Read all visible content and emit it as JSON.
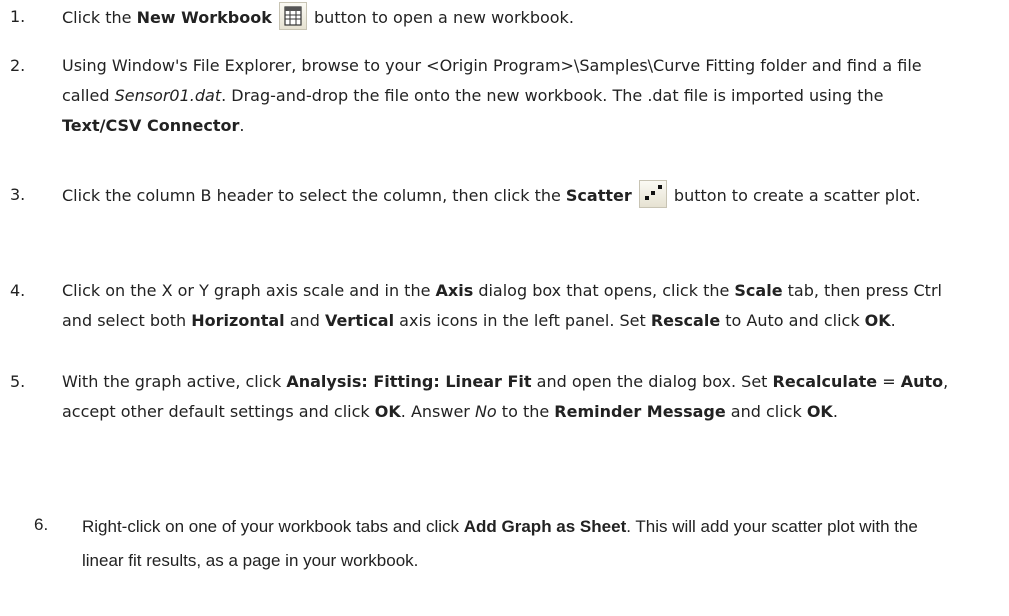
{
  "steps": [
    {
      "number": "1.",
      "parts": {
        "a": "Click the ",
        "b": "New Workbook",
        "c": " button to open a new workbook."
      },
      "icon": "new-workbook-icon"
    },
    {
      "number": "2.",
      "parts": {
        "a": "Using Window's File Explorer, browse to your <Origin Program>\\Samples\\Curve Fitting folder and find a file called ",
        "b": "Sensor01.dat",
        "c": ". Drag-and-drop the file onto the new workbook. The .dat file is imported using the ",
        "d": "Text/CSV Connector",
        "e": "."
      }
    },
    {
      "number": "3.",
      "parts": {
        "a": "Click the column B header to select the column, then click the ",
        "b": "Scatter",
        "c": " button to create a scatter plot."
      },
      "icon": "scatter-icon"
    },
    {
      "number": "4.",
      "parts": {
        "a": "Click on the X or Y graph axis scale and in the ",
        "b": "Axis",
        "c": " dialog box that opens, click the ",
        "d": "Scale",
        "e": " tab, then press Ctrl and select both ",
        "f": "Horizontal",
        "g": " and ",
        "h": "Vertical",
        "i": " axis icons in the left panel. Set ",
        "j": "Rescale",
        "k": " to Auto and click ",
        "l": "OK",
        "m": "."
      }
    },
    {
      "number": "5.",
      "parts": {
        "a": "With the graph active, click ",
        "b": "Analysis: Fitting: Linear Fit",
        "c": " and open the dialog box. Set ",
        "d": "Recalculate",
        "e": " = ",
        "f": "Auto",
        "g": ", accept other default settings and click ",
        "h": "OK",
        "i": ". Answer ",
        "j": "No",
        "k": " to the ",
        "l": "Reminder Message",
        "m": " and click ",
        "n": "OK",
        "o": "."
      }
    },
    {
      "number": "6.",
      "parts": {
        "a": "Right-click on one of your workbook tabs and click ",
        "b": "Add Graph as Sheet",
        "c": ". This will add your scatter plot with the linear fit results, as a page in your workbook."
      }
    }
  ]
}
